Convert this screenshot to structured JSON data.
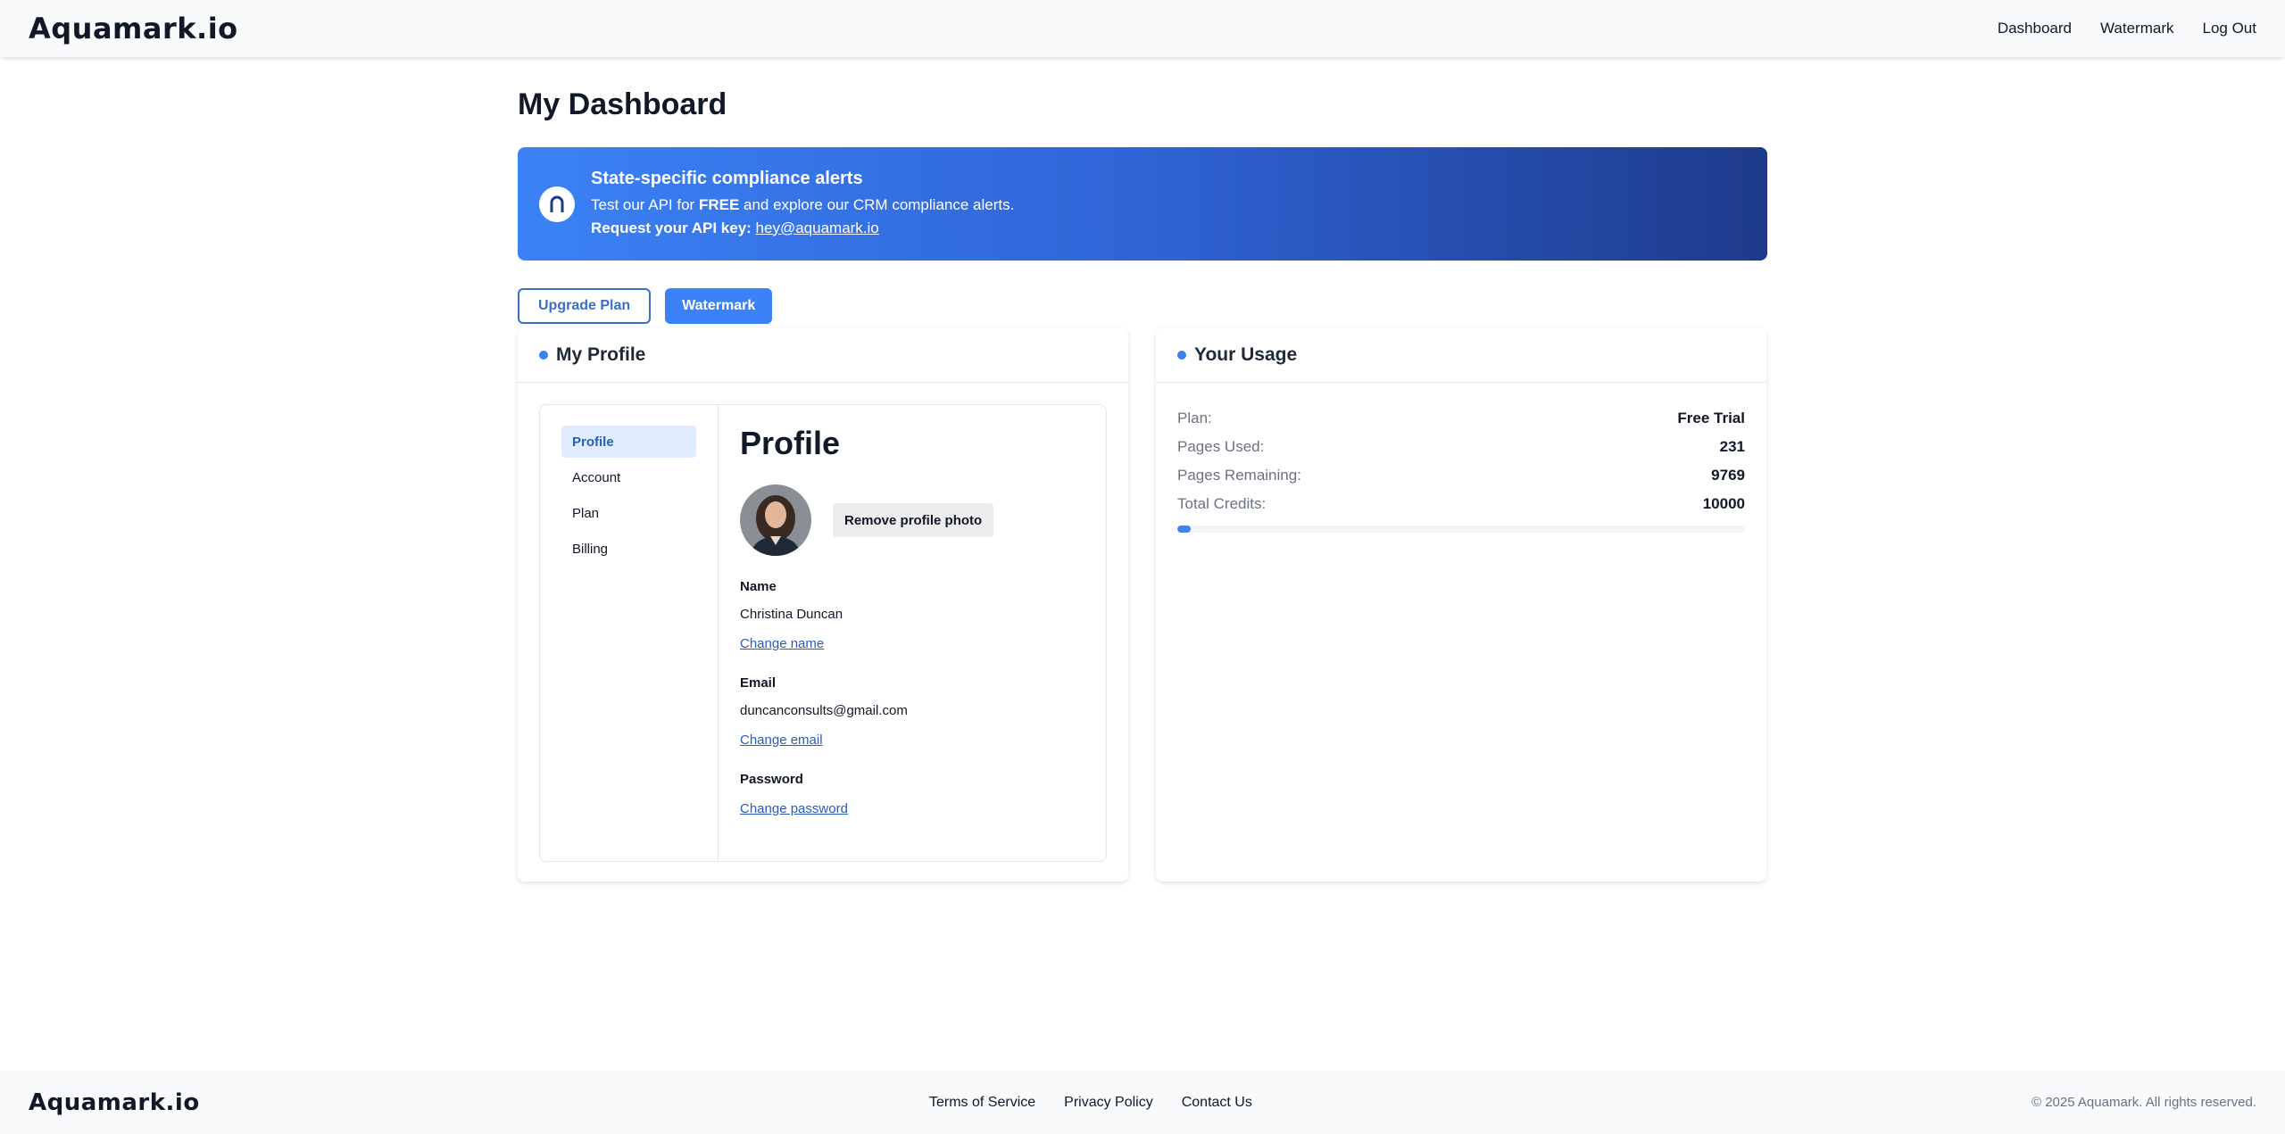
{
  "header": {
    "logo_text": "Aquamark.io",
    "nav": [
      "Dashboard",
      "Watermark",
      "Log Out"
    ]
  },
  "page": {
    "title": "My Dashboard"
  },
  "banner": {
    "title": "State-specific compliance alerts",
    "line1_prefix": "Test our API for ",
    "line1_bold": "FREE",
    "line1_suffix": " and explore our CRM compliance alerts.",
    "line2_label": "Request your API key:",
    "email": "hey@aquamark.io",
    "badge_icon": "arch-icon"
  },
  "actions": {
    "upgrade_label": "Upgrade Plan",
    "watermark_label": "Watermark"
  },
  "profile_card": {
    "title": "My Profile",
    "tabs": [
      "Profile",
      "Account",
      "Plan",
      "Billing"
    ],
    "active_tab": "Profile",
    "heading": "Profile",
    "remove_photo_label": "Remove profile photo",
    "name_label": "Name",
    "name_value": "Christina Duncan",
    "change_name": "Change name",
    "email_label": "Email",
    "email_value": "duncanconsults@gmail.com",
    "change_email": "Change email",
    "password_label": "Password",
    "change_password": "Change password"
  },
  "usage_card": {
    "title": "Your Usage",
    "plan_label": "Plan:",
    "plan_value": "Free Trial",
    "pages_used_label": "Pages Used:",
    "pages_used_value": "231",
    "pages_remaining_label": "Pages Remaining:",
    "pages_remaining_value": "9769",
    "total_credits_label": "Total Credits:",
    "total_credits_value": "10000",
    "progress_fraction": 0.0231
  },
  "footer": {
    "logo_text": "Aquamark.io",
    "links": [
      "Terms of Service",
      "Privacy Policy",
      "Contact Us"
    ],
    "copyright": "© 2025 Aquamark. All rights reserved."
  },
  "colors": {
    "accent": "#3b82f6",
    "banner_dark": "#1e3a8a",
    "link": "#2a5bb8"
  }
}
